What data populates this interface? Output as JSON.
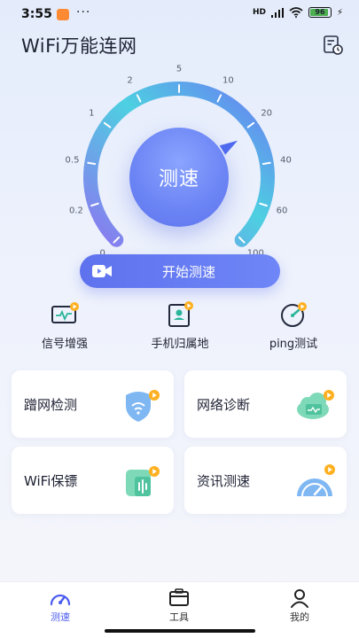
{
  "status_bar": {
    "time": "3:55",
    "dots": "···",
    "signal_text": "HD",
    "battery_level": "96",
    "battery_fraction": 0.96
  },
  "header": {
    "title": "WiFi万能连网",
    "history_icon": "history-clock-icon"
  },
  "gauge": {
    "center_label": "测速",
    "tick_labels": [
      "0",
      "0.2",
      "0.5",
      "1",
      "2",
      "5",
      "10",
      "20",
      "40",
      "60",
      "100"
    ],
    "colors": {
      "arc_start": "#8b78f0",
      "arc_mid": "#4dd0e1",
      "arc_end": "#6a7cf3",
      "ticks": "#ffffff"
    }
  },
  "start_button": {
    "label": "开始测速",
    "icon": "video-camera-icon"
  },
  "quick_tools": [
    {
      "label": "信号增强",
      "icon": "signal-monitor-icon"
    },
    {
      "label": "手机归属地",
      "icon": "phone-location-icon"
    },
    {
      "label": "ping测试",
      "icon": "ping-gauge-icon"
    }
  ],
  "cards": [
    {
      "label": "蹭网检测",
      "icon": "wifi-shield-icon"
    },
    {
      "label": "网络诊断",
      "icon": "cloud-monitor-icon"
    },
    {
      "label": "WiFi保镖",
      "icon": "sound-guard-icon"
    },
    {
      "label": "资讯测速",
      "icon": "speedometer-icon"
    }
  ],
  "bottom_nav": {
    "items": [
      {
        "label": "测速",
        "icon": "speedometer-icon",
        "active": true
      },
      {
        "label": "工具",
        "icon": "toolbox-icon",
        "active": false
      },
      {
        "label": "我的",
        "icon": "user-icon",
        "active": false
      }
    ]
  },
  "colors": {
    "accent": "#5f72ee",
    "badge": "#ffb020",
    "background": "#e4ecfb"
  }
}
